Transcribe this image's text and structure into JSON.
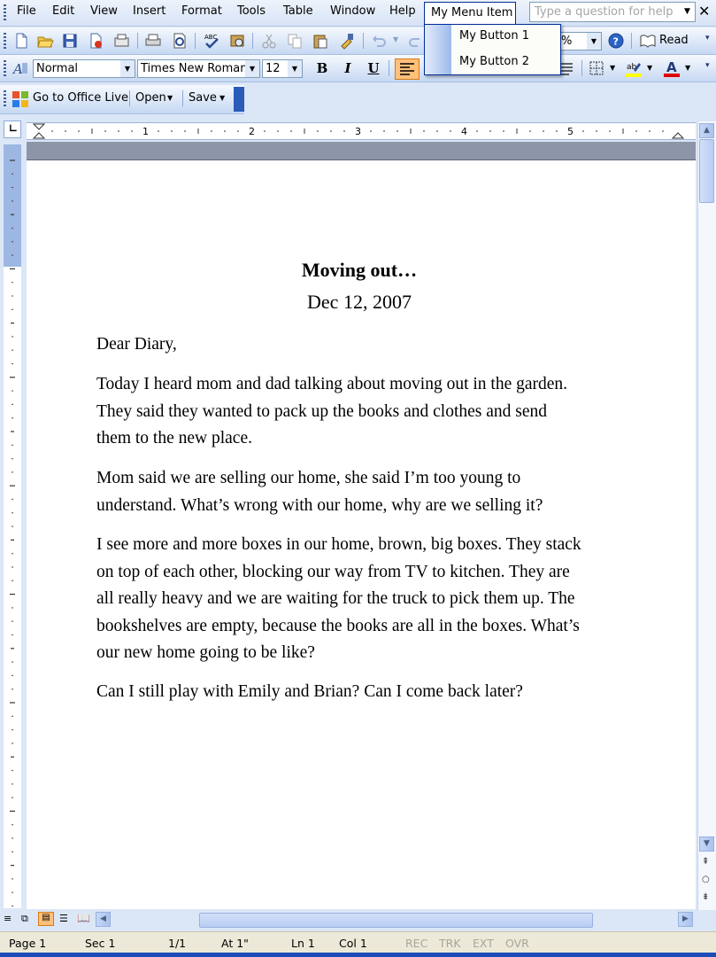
{
  "menubar": {
    "items": [
      "File",
      "Edit",
      "View",
      "Insert",
      "Format",
      "Tools",
      "Table",
      "Window",
      "Help"
    ],
    "custom_menu": "My Menu Item",
    "help_placeholder": "Type a question for help",
    "close_symbol": "✕"
  },
  "dropdown": {
    "items": [
      "My Button 1",
      "My Button 2"
    ]
  },
  "standard_toolbar": {
    "zoom_fragment": "%",
    "read_label": "Read"
  },
  "formatting_toolbar": {
    "style": "Normal",
    "font": "Times New Roman",
    "size": "12",
    "bold": "B",
    "italic": "I",
    "underline": "U"
  },
  "office_live_bar": {
    "go_label": "Go to Office Live",
    "open_label": "Open",
    "save_label": "Save"
  },
  "ruler": {
    "numbers": [
      "1",
      "2",
      "3",
      "4",
      "5"
    ]
  },
  "document": {
    "title": "Moving out…",
    "date": "Dec 12, 2007",
    "salutation": "Dear Diary,",
    "paragraphs": [
      [
        "Today I heard mom and dad talking about moving out in the garden.",
        "They said they wanted to pack up the books and clothes and send",
        "them to the new place."
      ],
      [
        "Mom said we are selling our home, she said I’m too young to",
        "understand. What’s wrong with our home, why are we selling it?"
      ],
      [
        "I see more and more boxes in our home, brown, big boxes. They stack",
        "on top of each other, blocking our way from TV to kitchen. They are",
        "all really heavy and we are waiting for the truck to pick them up. The",
        "bookshelves are empty, because the books are all in the boxes. What’s",
        "our new home going to be like?"
      ],
      [
        "Can I still play with Emily and Brian? Can I come back later?"
      ]
    ]
  },
  "statusbar": {
    "page": "Page  1",
    "sec": "Sec  1",
    "pages": "1/1",
    "at": "At  1\"",
    "ln": "Ln  1",
    "col": "Col  1",
    "rec": "REC",
    "trk": "TRK",
    "ext": "EXT",
    "ovr": "OVR"
  },
  "colors": {
    "accent": "#002d96",
    "toolbar": "#c6d8f3",
    "font_color_bar": "#e00000",
    "highlight_bar": "#ffff00",
    "active_align": "#ffc07a"
  }
}
